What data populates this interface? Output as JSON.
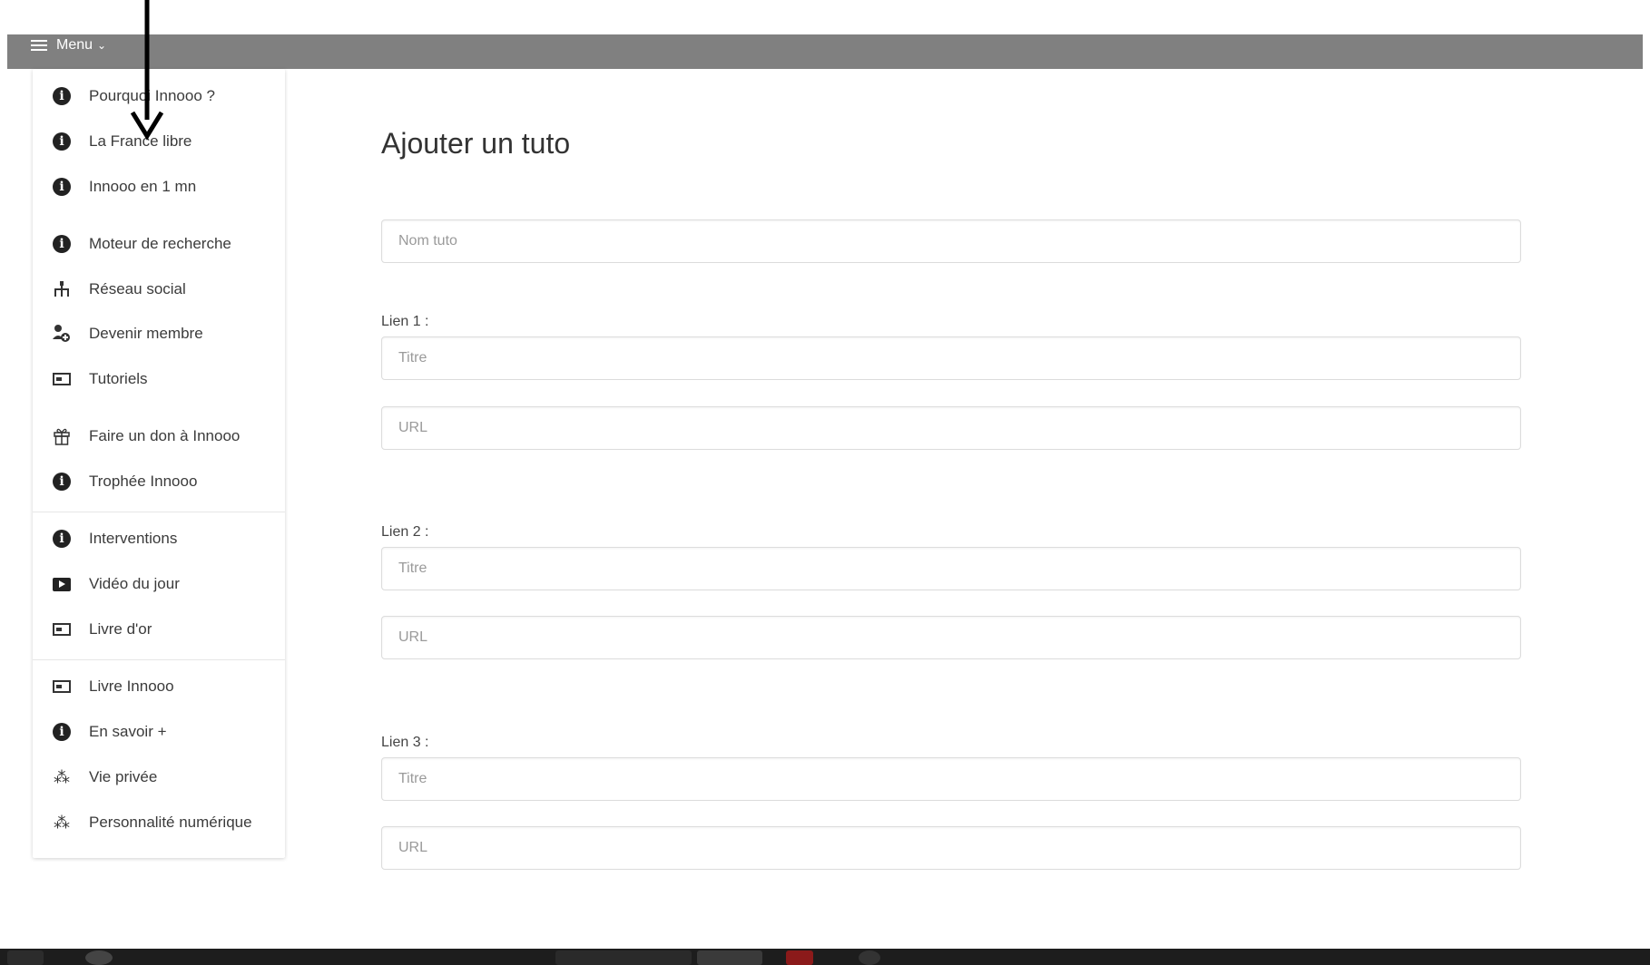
{
  "header": {
    "menu_label": "Menu",
    "menu_chevron": "⌄"
  },
  "sidebar": {
    "items": [
      {
        "label": "Pourquoi Innooo ?",
        "icon": "info-icon"
      },
      {
        "label": "La France libre",
        "icon": "info-icon"
      },
      {
        "label": "Innooo en 1 mn",
        "icon": "info-icon"
      },
      {
        "label": "Moteur de recherche",
        "icon": "info-icon"
      },
      {
        "label": "Réseau social",
        "icon": "network-icon"
      },
      {
        "label": "Devenir membre",
        "icon": "add-user-icon"
      },
      {
        "label": "Tutoriels",
        "icon": "list-icon"
      },
      {
        "label": "Faire un don à Innooo",
        "icon": "gift-icon"
      },
      {
        "label": "Trophée Innooo",
        "icon": "info-icon"
      },
      {
        "label": "Interventions",
        "icon": "info-icon"
      },
      {
        "label": "Vidéo du jour",
        "icon": "play-icon"
      },
      {
        "label": "Livre d'or",
        "icon": "list-icon"
      },
      {
        "label": "Livre Innooo",
        "icon": "list-icon"
      },
      {
        "label": "En savoir +",
        "icon": "info-icon"
      },
      {
        "label": "Vie privée",
        "icon": "sparkle-icon"
      },
      {
        "label": "Personnalité numérique",
        "icon": "sparkle-icon"
      }
    ]
  },
  "main": {
    "title": "Ajouter un tuto",
    "name_placeholder": "Nom tuto",
    "links": [
      {
        "label": "Lien 1 :",
        "title_placeholder": "Titre",
        "url_placeholder": "URL"
      },
      {
        "label": "Lien 2 :",
        "title_placeholder": "Titre",
        "url_placeholder": "URL"
      },
      {
        "label": "Lien 3 :",
        "title_placeholder": "Titre",
        "url_placeholder": "URL"
      }
    ]
  },
  "colors": {
    "topbar": "#808080",
    "taskbar": "#1d1d1d",
    "text": "#333333"
  }
}
